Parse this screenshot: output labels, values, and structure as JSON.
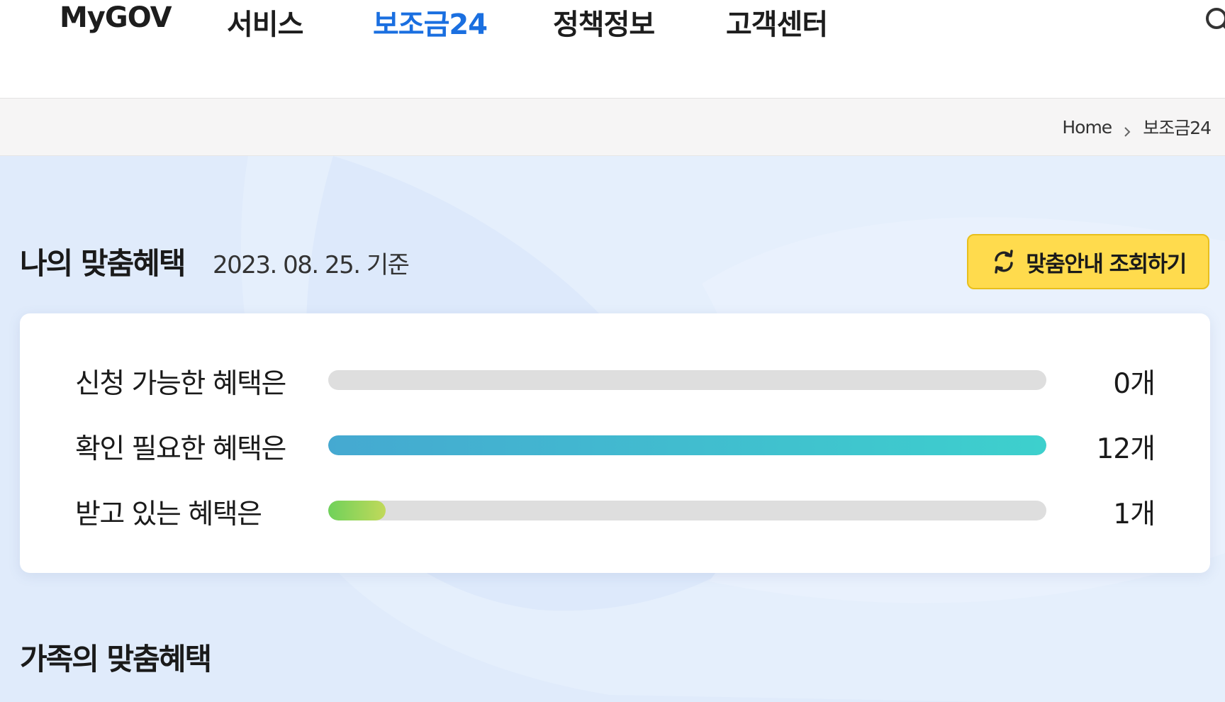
{
  "nav": {
    "items": [
      {
        "label": "MyGOV",
        "active": false
      },
      {
        "label": "서비스",
        "active": false
      },
      {
        "label": "보조금24",
        "active": true
      },
      {
        "label": "정책정보",
        "active": false
      },
      {
        "label": "고객센터",
        "active": false
      }
    ],
    "search_icon": "search-icon"
  },
  "breadcrumb": {
    "home": "Home",
    "separator_icon": "chevron-right-icon",
    "current": "보조금24"
  },
  "my_benefits": {
    "title": "나의 맞춤혜택",
    "date": "2023. 08. 25. 기준",
    "refresh_button": {
      "label": "맞춤안내 조회하기",
      "icon": "refresh-icon"
    },
    "rows": [
      {
        "label": "신청 가능한 혜택은",
        "count": "0개",
        "fill_percent": 0,
        "color": "none"
      },
      {
        "label": "확인 필요한 혜택은",
        "count": "12개",
        "fill_percent": 100,
        "color": "blue"
      },
      {
        "label": "받고 있는 혜택은",
        "count": "1개",
        "fill_percent": 8,
        "color": "green"
      }
    ]
  },
  "family_benefits": {
    "title": "가족의 맞춤혜택"
  },
  "colors": {
    "accent_blue": "#1a6fe0",
    "button_yellow": "#ffdb4d",
    "background": "#e0ebfb",
    "bar_blue_start": "#45a9d1",
    "bar_blue_end": "#3dd0cd",
    "bar_green_start": "#6fd15a",
    "bar_green_end": "#c1d95a"
  }
}
